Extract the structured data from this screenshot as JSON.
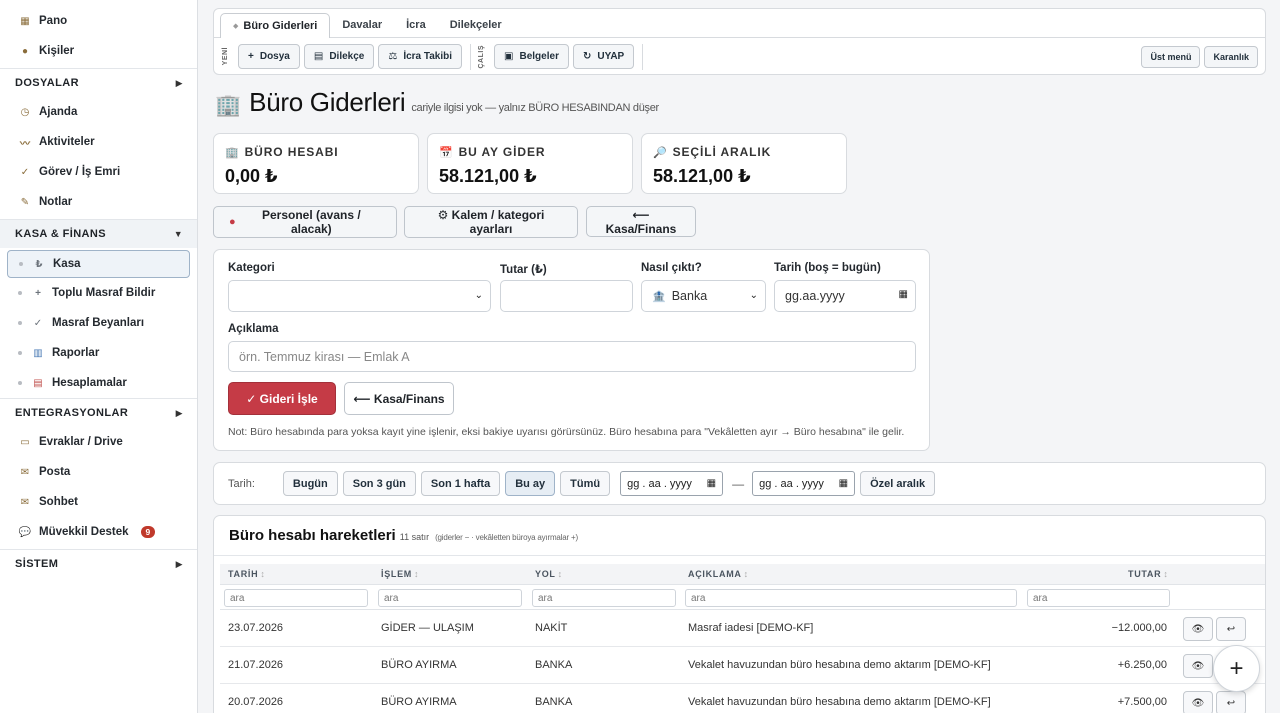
{
  "sidebar": {
    "top": [
      {
        "icon": "dashboard-icon",
        "glyph": "▦",
        "label": "Pano"
      },
      {
        "icon": "people-icon",
        "glyph": "●",
        "label": "Kişiler"
      }
    ],
    "sections": [
      {
        "title": "DOSYALAR",
        "arrow": "▶"
      },
      {
        "title": "KASA & FİNANS",
        "arrow": "▼"
      },
      {
        "title": "ENTEGRASYONLAR",
        "arrow": "▶"
      },
      {
        "title": "SİSTEM",
        "arrow": "▶"
      }
    ],
    "dosyalar_items": [
      {
        "glyph": "◷",
        "label": "Ajanda"
      },
      {
        "glyph": "〰",
        "label": "Aktiviteler"
      },
      {
        "glyph": "✓",
        "label": "Görev / İş Emri"
      },
      {
        "glyph": "✎",
        "label": "Notlar"
      }
    ],
    "kasa_items": [
      {
        "glyph": "₺",
        "label": "Kasa"
      },
      {
        "glyph": "+",
        "label": "Toplu Masraf Bildir"
      },
      {
        "glyph": "✓",
        "label": "Masraf Beyanları"
      },
      {
        "glyph": "▥",
        "label": "Raporlar"
      },
      {
        "glyph": "▤",
        "label": "Hesaplamalar"
      }
    ],
    "entegrasyon_items": [
      {
        "glyph": "▭",
        "label": "Evraklar / Drive"
      },
      {
        "glyph": "✉",
        "label": "Posta"
      },
      {
        "glyph": "✉",
        "label": "Sohbet"
      },
      {
        "glyph": "💬",
        "label": "Müvekkil Destek",
        "badge": "9"
      }
    ]
  },
  "topbar": {
    "tabs": [
      "Büro Giderleri",
      "Davalar",
      "İcra",
      "Dilekçeler"
    ],
    "left_label": "YENİ",
    "mid_label": "ÇALIŞ",
    "new_buttons": [
      {
        "glyph": "+",
        "label": "Dosya"
      },
      {
        "glyph": "▤",
        "label": "Dilekçe"
      },
      {
        "glyph": "⚖",
        "label": "İcra Takibi"
      }
    ],
    "work_buttons": [
      {
        "glyph": "▣",
        "label": "Belgeler"
      },
      {
        "glyph": "↻",
        "label": "UYAP"
      }
    ],
    "right_buttons": [
      "Üst menü",
      "Karanlık"
    ]
  },
  "page": {
    "title": "Büro Giderleri",
    "subtitle": "cariyle ilgisi yok — yalnız BÜRO HESABINDAN düşer"
  },
  "stats": [
    {
      "glyph": "🏢",
      "label": "BÜRO HESABI",
      "value": "0,00 ₺"
    },
    {
      "glyph": "📅",
      "label": "BU AY GİDER",
      "value": "58.121,00 ₺"
    },
    {
      "glyph": "🔎",
      "label": "SEÇİLİ ARALIK",
      "value": "58.121,00 ₺"
    }
  ],
  "actions": {
    "personel": "Personel (avans / alacak)",
    "kalem": "⚙ Kalem / kategori ayarları",
    "back": "⟵ Kasa/Finans"
  },
  "form": {
    "kategori_label": "Kategori",
    "tutar_label": "Tutar (₺)",
    "nasil_label": "Nasıl çıktı?",
    "nasil_value": "Banka",
    "tarih_label": "Tarih (boş = bugün)",
    "tarih_placeholder": "gg.aa.yyyy",
    "aciklama_label": "Açıklama",
    "aciklama_placeholder": "örn. Temmuz kirası — Emlak A",
    "save": "✓ Gideri İşle",
    "back": "⟵ Kasa/Finans",
    "note": "Not: Büro hesabında para yoksa kayıt yine işlenir, eksi bakiye uyarısı görürsünüz. Büro hesabına para \"Vekâletten ayır → Büro hesabına\" ile gelir."
  },
  "filter": {
    "label": "Tarih:",
    "buttons": [
      "Bugün",
      "Son 3 gün",
      "Son 1 hafta",
      "Bu ay",
      "Tümü"
    ],
    "active": "Bu ay",
    "date_placeholder": "gg . aa . yyyy",
    "dash": "—",
    "custom": "Özel aralık"
  },
  "table": {
    "title": "Büro hesabı hareketleri",
    "count": "11 satır",
    "hint": "(giderler − · vekâletten büroya ayırmalar +)",
    "columns": [
      "TARİH",
      "İŞLEM",
      "YOL",
      "AÇIKLAMA",
      "TUTAR"
    ],
    "filter_placeholder": "ara",
    "rows": [
      {
        "tarih": "23.07.2026",
        "islem": "GİDER — ULAŞIM",
        "yol": "NAKİT",
        "aciklama": "Masraf iadesi [DEMO-KF]",
        "tutar": "−12.000,00"
      },
      {
        "tarih": "21.07.2026",
        "islem": "BÜRO AYIRMA",
        "yol": "BANKA",
        "aciklama": "Vekalet havuzundan büro hesabına demo aktarım [DEMO-KF]",
        "tutar": "+6.250,00"
      },
      {
        "tarih": "20.07.2026",
        "islem": "BÜRO AYIRMA",
        "yol": "BANKA",
        "aciklama": "Vekalet havuzundan büro hesabına demo aktarım [DEMO-KF]",
        "tutar": "+7.500,00"
      }
    ]
  },
  "fab": "+"
}
